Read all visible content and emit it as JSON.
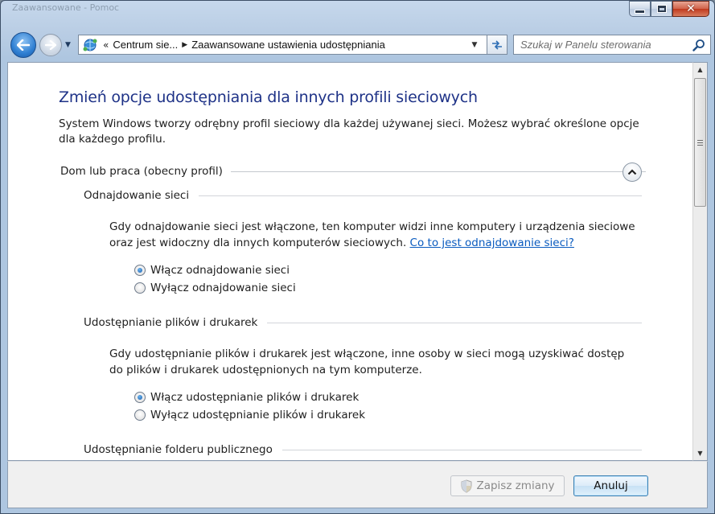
{
  "window": {
    "title": "Zaawansowane - Pomoc"
  },
  "nav": {
    "breadcrumb_prefix": "«",
    "crumbs": [
      "Centrum sie...",
      "Zaawansowane ustawienia udostępniania"
    ],
    "crumb_sep": "▶",
    "search_placeholder": "Szukaj w Panelu sterowania"
  },
  "page": {
    "heading": "Zmień opcje udostępniania dla innych profili sieciowych",
    "intro": "System Windows tworzy odrębny profil sieciowy dla każdej używanej sieci. Możesz wybrać określone opcje dla każdego profilu."
  },
  "profile": {
    "title": "Dom lub praca (obecny profil)",
    "sections": [
      {
        "title": "Odnajdowanie sieci",
        "description": "Gdy odnajdowanie sieci jest włączone, ten komputer widzi inne komputery i urządzenia sieciowe oraz jest widoczny dla innych komputerów sieciowych.",
        "link": "Co to jest odnajdowanie sieci?",
        "options": [
          {
            "label": "Włącz odnajdowanie sieci",
            "selected": true
          },
          {
            "label": "Wyłącz odnajdowanie sieci",
            "selected": false
          }
        ]
      },
      {
        "title": "Udostępnianie plików i drukarek",
        "description": "Gdy udostępnianie plików i drukarek jest włączone, inne osoby w sieci mogą uzyskiwać dostęp do plików i drukarek udostępnionych na tym komputerze.",
        "options": [
          {
            "label": "Włącz udostępnianie plików i drukarek",
            "selected": true
          },
          {
            "label": "Wyłącz udostępnianie plików i drukarek",
            "selected": false
          }
        ]
      },
      {
        "title": "Udostępnianie folderu publicznego"
      }
    ]
  },
  "footer": {
    "save_label": "Zapisz zmiany",
    "save_enabled": false,
    "cancel_label": "Anuluj"
  },
  "colors": {
    "heading": "#1e3287",
    "link": "#0a5bbf",
    "accent": "#2f7fd2"
  }
}
